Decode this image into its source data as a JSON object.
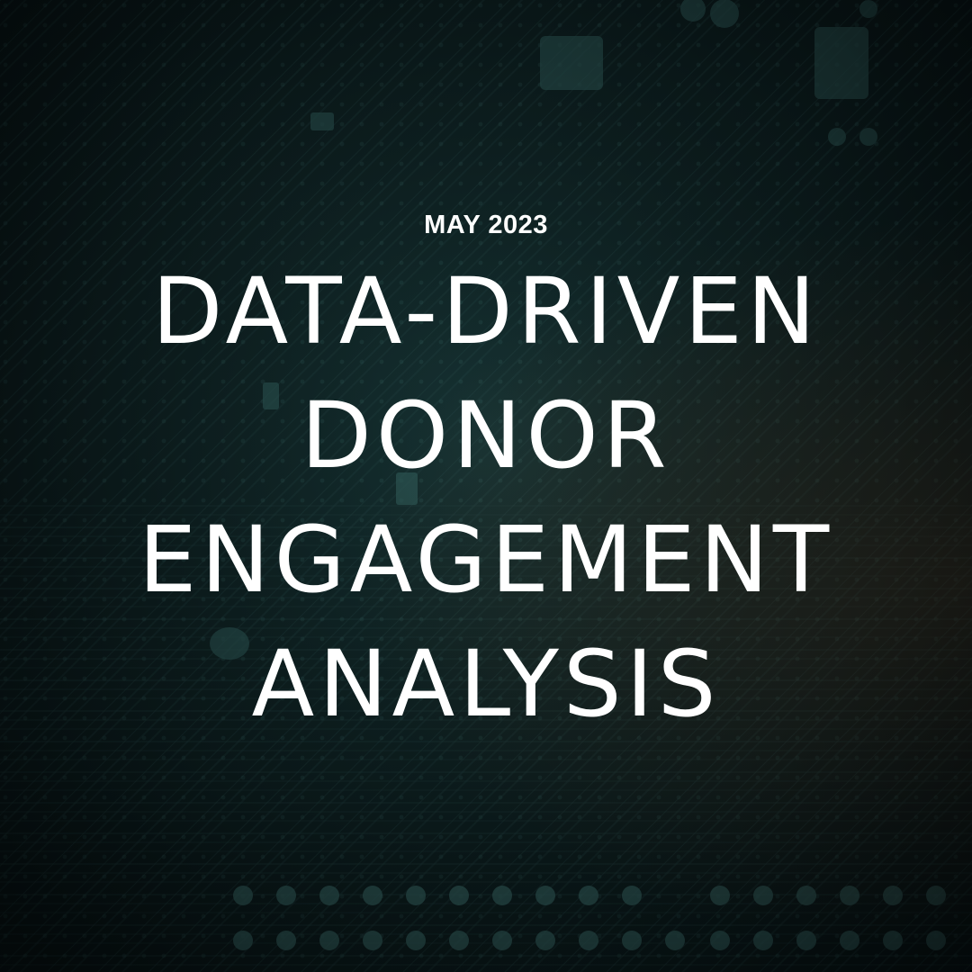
{
  "poster": {
    "date": "MAY 2023",
    "headline_lines": [
      "DATA-DRIVEN",
      "DONOR",
      "ENGAGEMENT",
      "ANALYSIS"
    ]
  },
  "background": {
    "description_icon": "circuit-board-image",
    "colors": {
      "base": "#0d1a1b",
      "trace": "#2f5a5a",
      "pad": "#4d8c88",
      "warm_glow": "#8c5028"
    }
  }
}
